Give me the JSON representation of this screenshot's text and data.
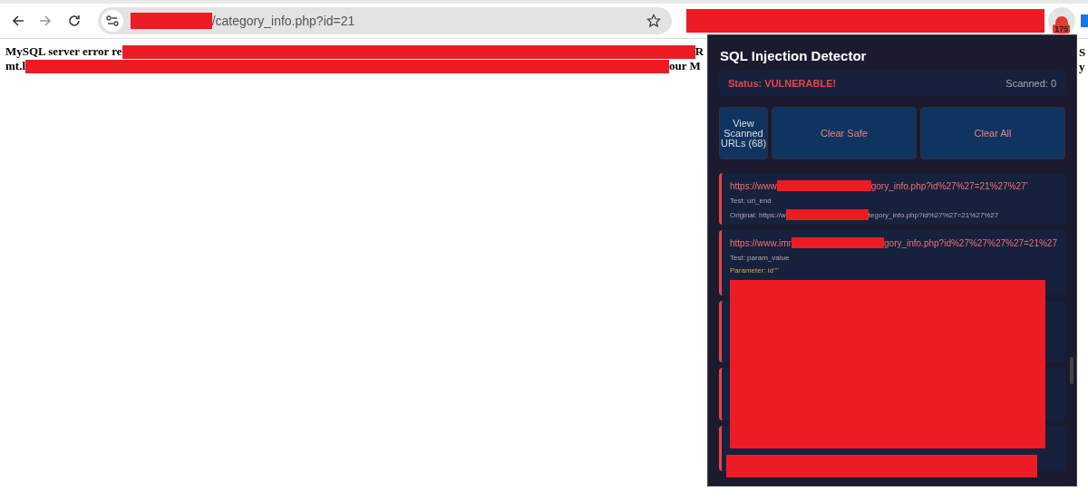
{
  "browser": {
    "address": "/category_info.php?id=21",
    "extension_badge": "175"
  },
  "page": {
    "lines": [
      {
        "start": "MySQL server error re",
        "end": "R",
        "right": "S"
      },
      {
        "start": "mt.l",
        "end": "our M",
        "right": "y"
      }
    ]
  },
  "popup": {
    "title": "SQL Injection Detector",
    "status": "Status: VULNERABLE!",
    "scanned": "Scanned: 0",
    "buttons": [
      {
        "label": "View Scanned URLs (68)",
        "kind": "narrow"
      },
      {
        "label": "Clear Safe",
        "kind": "wide"
      },
      {
        "label": "Clear All",
        "kind": "wide"
      }
    ],
    "results": [
      {
        "kind": "entry",
        "url_start": "https://www",
        "url_end": "gory_info.php?id%27%27=21%27%27'",
        "test": "Test: url_end",
        "original_start": "Original: https://w",
        "original_end": "tegory_info.php?id%27%27=21%27%27"
      },
      {
        "kind": "entry",
        "url_start": "https://www.imr",
        "url_end": "gory_info.php?id%27%27%27%27=21%27",
        "test": "Test: param_value",
        "parameter": "Parameter: id''''"
      },
      {
        "kind": "redacted"
      },
      {
        "kind": "redacted"
      },
      {
        "kind": "redacted"
      }
    ]
  }
}
